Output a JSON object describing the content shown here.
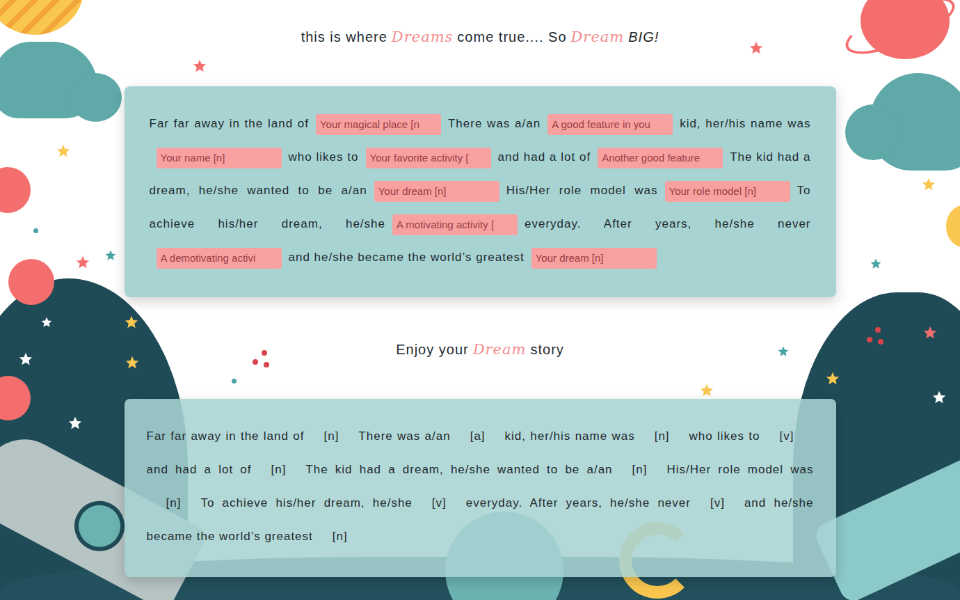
{
  "header": {
    "before": "this is where",
    "accent1": "Dreams",
    "middle": "come true.... So",
    "accent2": "Dream",
    "after": "BIG!"
  },
  "form": {
    "segments": [
      {
        "text": "Far far away in the land of",
        "placeholder": "Your magical place [n"
      },
      {
        "text": "There was a/an",
        "placeholder": "A good feature in you"
      },
      {
        "text": "kid, her/his name was",
        "placeholder": "Your name [n]"
      },
      {
        "text": "who likes to",
        "placeholder": "Your favorite activity ["
      },
      {
        "text": "and had a lot of",
        "placeholder": "Another good feature"
      },
      {
        "text": "The kid had a dream, he/she wanted to be a/an",
        "placeholder": "Your dream [n]"
      },
      {
        "text": "His/Her role model was",
        "placeholder": "Your role model [n]"
      },
      {
        "text": "To achieve his/her dream, he/she",
        "placeholder": "A motivating activity ["
      },
      {
        "text": "everyday. After years, he/she never",
        "placeholder": "A demotivating activi"
      },
      {
        "text": "and he/she became the world’s greatest",
        "placeholder": "Your dream [n]"
      }
    ]
  },
  "subheader": {
    "before": "Enjoy your",
    "accent": "Dream",
    "after": "story"
  },
  "result": {
    "segments": [
      {
        "text": "Far far away in the land of",
        "blank": "[n]"
      },
      {
        "text": "There was a/an",
        "blank": "[a]"
      },
      {
        "text": "kid, her/his name was",
        "blank": "[n]"
      },
      {
        "text": "who likes to",
        "blank": "[v]"
      },
      {
        "text": "and had a lot of",
        "blank": "[n]"
      },
      {
        "text": "The kid had a dream, he/she wanted to be a/an",
        "blank": "[n]"
      },
      {
        "text": "His/Her role model was",
        "blank": "[n]"
      },
      {
        "text": "To achieve his/her dream, he/she",
        "blank": "[v]"
      },
      {
        "text": "everyday. After years, he/she never",
        "blank": "[v]"
      },
      {
        "text": "and he/she became the world’s greatest",
        "blank": "[n]"
      }
    ]
  }
}
